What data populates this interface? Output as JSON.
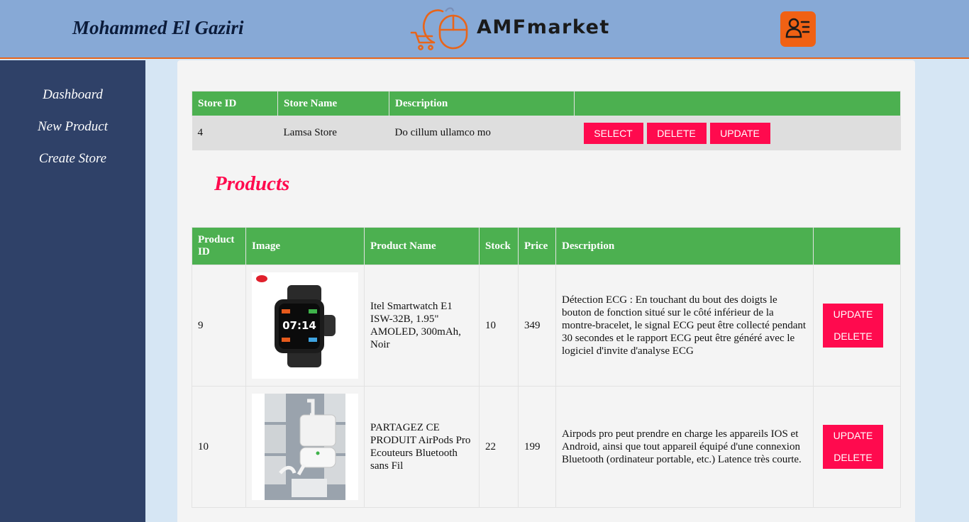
{
  "header": {
    "user_name": "Mohammed El Gaziri",
    "logo_text": "AMFmarket",
    "logo_icon": "cart-mouse-logo-icon",
    "profile_icon": "user-profile-icon",
    "accent_color": "#f06114"
  },
  "sidebar": {
    "items": [
      {
        "label": "Dashboard"
      },
      {
        "label": "New Product"
      },
      {
        "label": "Create Store"
      }
    ]
  },
  "store_table": {
    "headers": [
      "Store ID",
      "Store Name",
      "Description",
      ""
    ],
    "rows": [
      {
        "id": "4",
        "name": "Lamsa Store",
        "description": "Do cillum ullamco mo",
        "select": "SELECT",
        "delete": "DELETE",
        "update": "UPDATE"
      }
    ]
  },
  "products": {
    "title": "Products",
    "headers": {
      "id": "Product ID",
      "image": "Image",
      "name": "Product Name",
      "stock": "Stock",
      "price": "Price",
      "description": "Description",
      "actions": ""
    },
    "rows": [
      {
        "id": "9",
        "image": "smartwatch-image",
        "name": "Itel Smartwatch E1 ISW-32B, 1.95\" AMOLED, 300mAh, Noir",
        "stock": "10",
        "price": "349",
        "description": "Détection ECG : En touchant du bout des doigts le bouton de fonction situé sur le côté inférieur de la montre-bracelet, le signal ECG peut être collecté pendant 30 secondes et le rapport ECG peut être généré avec le logiciel d'invite d'analyse ECG",
        "update": "UPDATE",
        "delete": "DELETE"
      },
      {
        "id": "10",
        "image": "airpods-image",
        "name": "PARTAGEZ CE PRODUIT AirPods Pro Ecouteurs Bluetooth sans Fil",
        "stock": "22",
        "price": "199",
        "description": "Airpods pro peut prendre en charge les appareils IOS et Android, ainsi que tout appareil équipé d'une connexion Bluetooth (ordinateur portable, etc.) Latence très courte.",
        "update": "UPDATE",
        "delete": "DELETE"
      }
    ]
  },
  "colors": {
    "header_bg": "#87a9d6",
    "sidebar_bg": "#2f4168",
    "table_header": "#4cb050",
    "button": "#ff0a4e"
  }
}
